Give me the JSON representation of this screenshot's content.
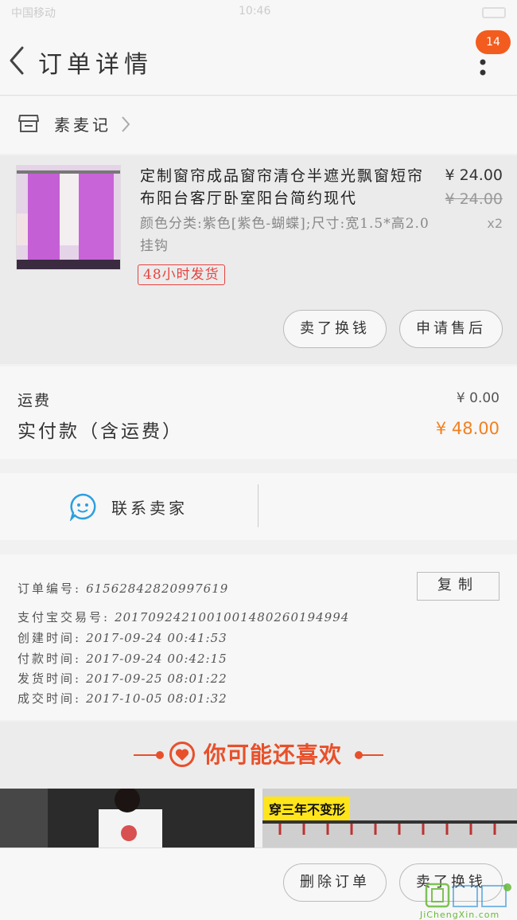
{
  "status_bar": {
    "left": "中国移动",
    "time": "10:46"
  },
  "header": {
    "title": "订单详情",
    "badge_count": "14"
  },
  "shop": {
    "name": "素麦记"
  },
  "product": {
    "title": "定制窗帘成品窗帘清仓半遮光飘窗短帘布阳台客厅卧室阳台简约现代",
    "spec": "颜色分类:紫色[紫色-蝴蝶];尺寸:宽1.5*高2.0挂钩",
    "tag": "48小时发货",
    "price": "¥ 24.00",
    "original_price": "¥ 24.00",
    "quantity": "x2",
    "buttons": {
      "refund": "卖了换钱",
      "after_sale": "申请售后"
    }
  },
  "fees": {
    "shipping_label": "运费",
    "shipping_value": "¥ 0.00",
    "paid_label": "实付款（含运费）",
    "paid_value": "¥ 48.00"
  },
  "contact": {
    "label": "联系卖家"
  },
  "order_info": {
    "copy_label": "复制",
    "rows": [
      {
        "key": "订单编号:",
        "value": "61562842820997619"
      },
      {
        "key": "支付宝交易号:",
        "value": "2017092421001001480260194994"
      },
      {
        "key": "创建时间:",
        "value": "2017-09-24 00:41:53"
      },
      {
        "key": "付款时间:",
        "value": "2017-09-24 00:42:15"
      },
      {
        "key": "发货时间:",
        "value": "2017-09-25 08:01:22"
      },
      {
        "key": "成交时间:",
        "value": "2017-10-05 08:01:32"
      }
    ]
  },
  "recommend": {
    "title": "你可能还喜欢",
    "tag": "穿三年不变形"
  },
  "bottom": {
    "delete_label": "删除订单",
    "sell_label": "卖了换钱"
  },
  "watermark": {
    "text": "JiChengXin.com",
    "brand": "集诚信"
  },
  "colors": {
    "accent": "#f3801f",
    "brand": "#e8502a",
    "badge": "#f35c1f",
    "tag": "#e64340"
  }
}
